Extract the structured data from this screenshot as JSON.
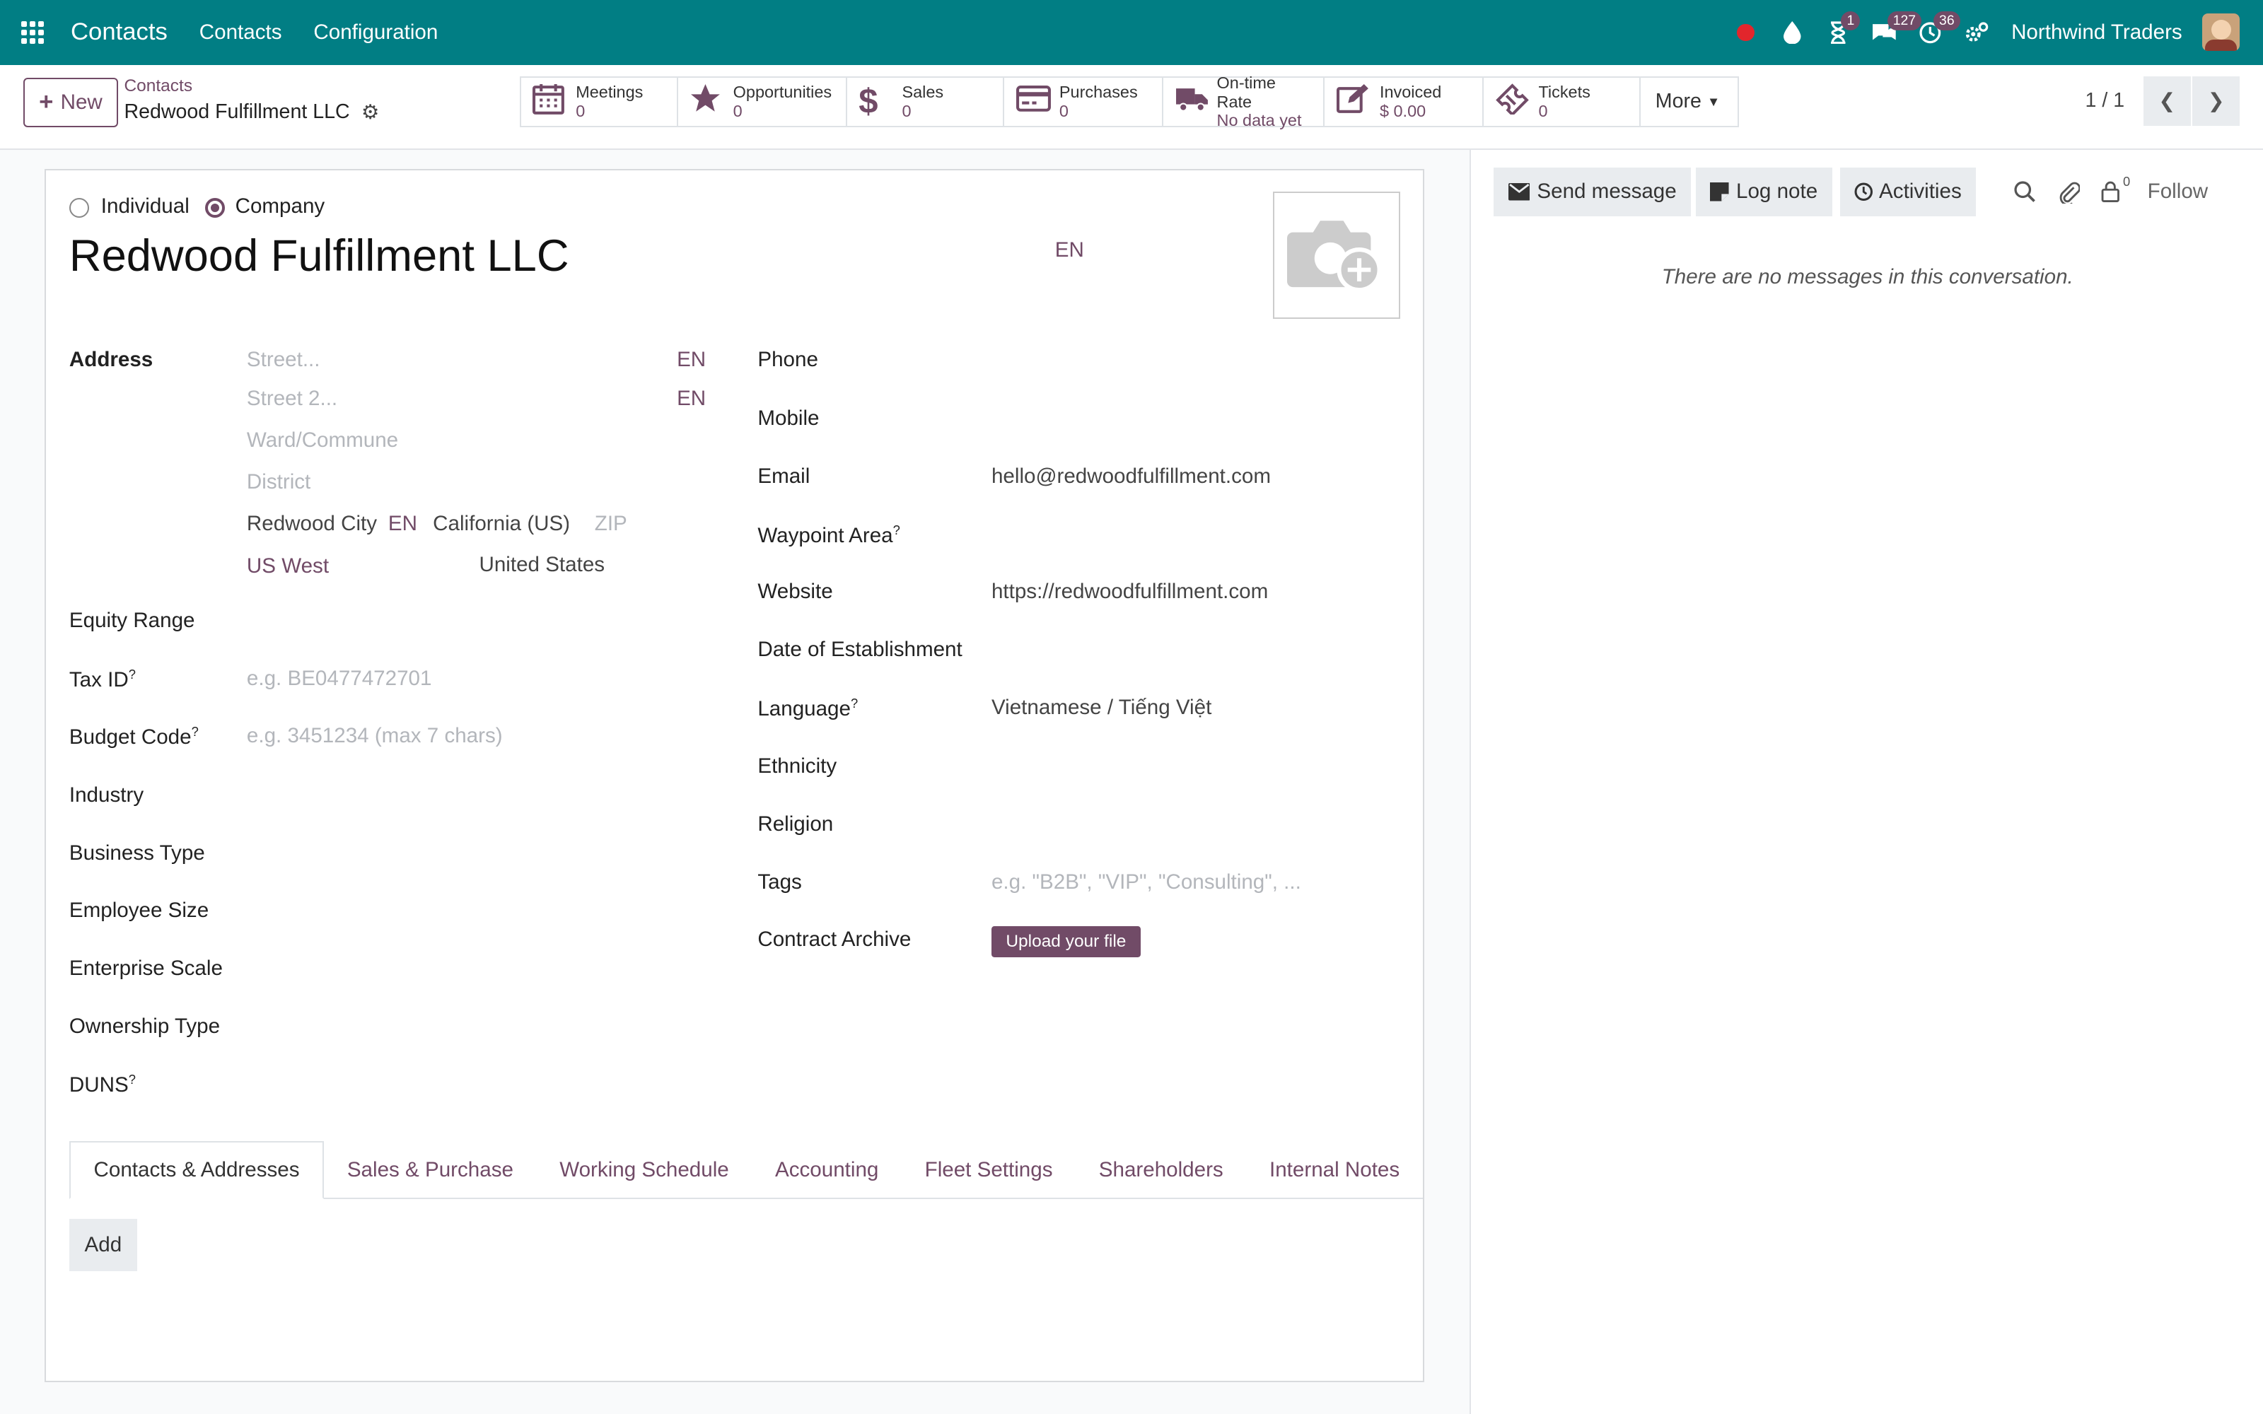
{
  "topbar": {
    "app_title": "Contacts",
    "menus": [
      "Contacts",
      "Configuration"
    ],
    "badges": {
      "activities": "1",
      "messages": "127",
      "clock": "36"
    },
    "company": "Northwind Traders"
  },
  "control": {
    "new_label": "New",
    "breadcrumb": "Contacts",
    "record_name": "Redwood Fulfillment LLC",
    "stats": [
      {
        "label": "Meetings",
        "value": "0"
      },
      {
        "label": "Opportunities",
        "value": "0"
      },
      {
        "label": "Sales",
        "value": "0"
      },
      {
        "label": "Purchases",
        "value": "0"
      },
      {
        "label": "On-time Rate",
        "value": "No data yet"
      },
      {
        "label": "Invoiced",
        "value": "$ 0.00"
      },
      {
        "label": "Tickets",
        "value": "0"
      }
    ],
    "more_label": "More",
    "pager": "1 / 1"
  },
  "form": {
    "type_individual": "Individual",
    "type_company": "Company",
    "name": "Redwood Fulfillment LLC",
    "lang_tag": "EN",
    "address_label": "Address",
    "street_ph": "Street...",
    "street2_ph": "Street 2...",
    "ward_ph": "Ward/Commune",
    "district_ph": "District",
    "city": "Redwood City",
    "state": "California (US)",
    "zip_ph": "ZIP",
    "region": "US West",
    "country": "United States",
    "left_labels": {
      "equity": "Equity Range",
      "taxid": "Tax ID",
      "budget": "Budget Code",
      "industry": "Industry",
      "business": "Business Type",
      "employee": "Employee Size",
      "enterprise": "Enterprise Scale",
      "ownership": "Ownership Type",
      "duns": "DUNS"
    },
    "taxid_ph": "e.g. BE0477472701",
    "budget_ph": "e.g. 3451234 (max 7 chars)",
    "right_labels": {
      "phone": "Phone",
      "mobile": "Mobile",
      "email": "Email",
      "waypoint": "Waypoint Area",
      "website": "Website",
      "establish": "Date of Establishment",
      "language": "Language",
      "ethnicity": "Ethnicity",
      "religion": "Religion",
      "tags": "Tags",
      "contract": "Contract Archive"
    },
    "email": "hello@redwoodfulfillment.com",
    "website": "https://redwoodfulfillment.com",
    "language": "Vietnamese / Tiếng Việt",
    "tags_ph": "e.g. \"B2B\", \"VIP\", \"Consulting\", ...",
    "upload_label": "Upload your file",
    "help_mark": "?",
    "tabs": [
      "Contacts & Addresses",
      "Sales & Purchase",
      "Working Schedule",
      "Accounting",
      "Fleet Settings",
      "Shareholders",
      "Internal Notes"
    ],
    "add_label": "Add"
  },
  "chatter": {
    "send": "Send message",
    "log": "Log note",
    "activities": "Activities",
    "follower_count": "0",
    "follow": "Follow",
    "empty": "There are no messages in this conversation."
  }
}
